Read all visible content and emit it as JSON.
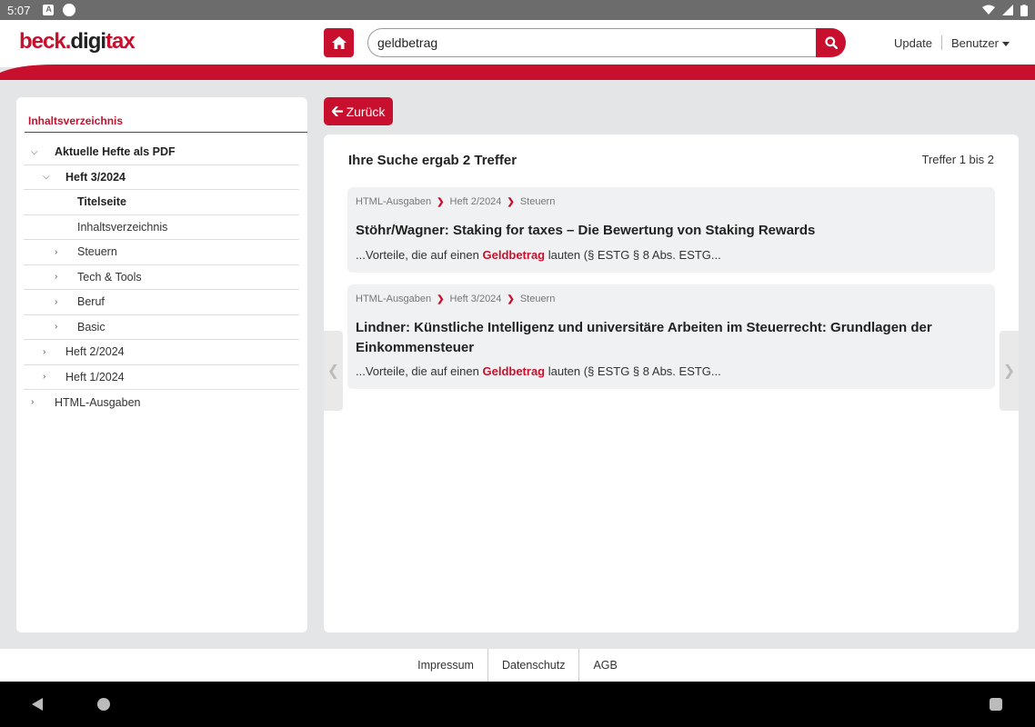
{
  "status_bar": {
    "time": "5:07"
  },
  "header": {
    "logo": {
      "part1": "beck",
      "dot": ".",
      "part2": "digi",
      "part3": "tax"
    },
    "search": {
      "value": "geldbetrag",
      "placeholder": ""
    },
    "links": {
      "update": "Update",
      "user": "Benutzer"
    }
  },
  "sidebar": {
    "title": "Inhaltsverzeichnis",
    "tree": [
      {
        "label": "Aktuelle Hefte als PDF",
        "level": 0,
        "state": "expanded"
      },
      {
        "label": "Heft 3/2024",
        "level": 1,
        "state": "expanded"
      },
      {
        "label": "Titelseite",
        "level": 2,
        "state": "selected"
      },
      {
        "label": "Inhaltsverzeichnis",
        "level": 2,
        "state": "leaf"
      },
      {
        "label": "Steuern",
        "level": 2,
        "state": "collapsed"
      },
      {
        "label": "Tech & Tools",
        "level": 2,
        "state": "collapsed"
      },
      {
        "label": "Beruf",
        "level": 2,
        "state": "collapsed"
      },
      {
        "label": "Basic",
        "level": 2,
        "state": "collapsed"
      },
      {
        "label": "Heft 2/2024",
        "level": 1,
        "state": "collapsed"
      },
      {
        "label": "Heft 1/2024",
        "level": 1,
        "state": "collapsed"
      },
      {
        "label": "HTML-Ausgaben",
        "level": 0,
        "state": "collapsed"
      }
    ]
  },
  "back_button": {
    "label": "Zurück"
  },
  "results": {
    "heading": "Ihre Suche ergab 2 Treffer",
    "count": "Treffer 1 bis 2",
    "items": [
      {
        "breadcrumb": [
          "HTML-Ausgaben",
          "Heft 2/2024",
          "Steuern"
        ],
        "title": "Stöhr/Wagner: Staking for taxes – Die Bewertung von Staking Rewards",
        "snippet_before": "...Vorteile, die auf einen ",
        "snippet_hit": "Geldbetrag",
        "snippet_after": " lauten (§ ESTG § 8 Abs. ESTG..."
      },
      {
        "breadcrumb": [
          "HTML-Ausgaben",
          "Heft 3/2024",
          "Steuern"
        ],
        "title": "Lindner: Künstliche Intelligenz und universitäre Arbeiten im Steuerrecht: Grundlagen der Einkommensteuer",
        "snippet_before": "...Vorteile, die auf einen ",
        "snippet_hit": "Geldbetrag",
        "snippet_after": " lauten (§ ESTG § 8 Abs. ESTG..."
      }
    ]
  },
  "nav_arrows": {
    "left": "❮",
    "right": "❯"
  },
  "footer": {
    "links": [
      "Impressum",
      "Datenschutz",
      "AGB"
    ]
  },
  "colors": {
    "brand_red": "#c8102e",
    "background": "#e4e5e7",
    "card": "#f0f1f2"
  }
}
